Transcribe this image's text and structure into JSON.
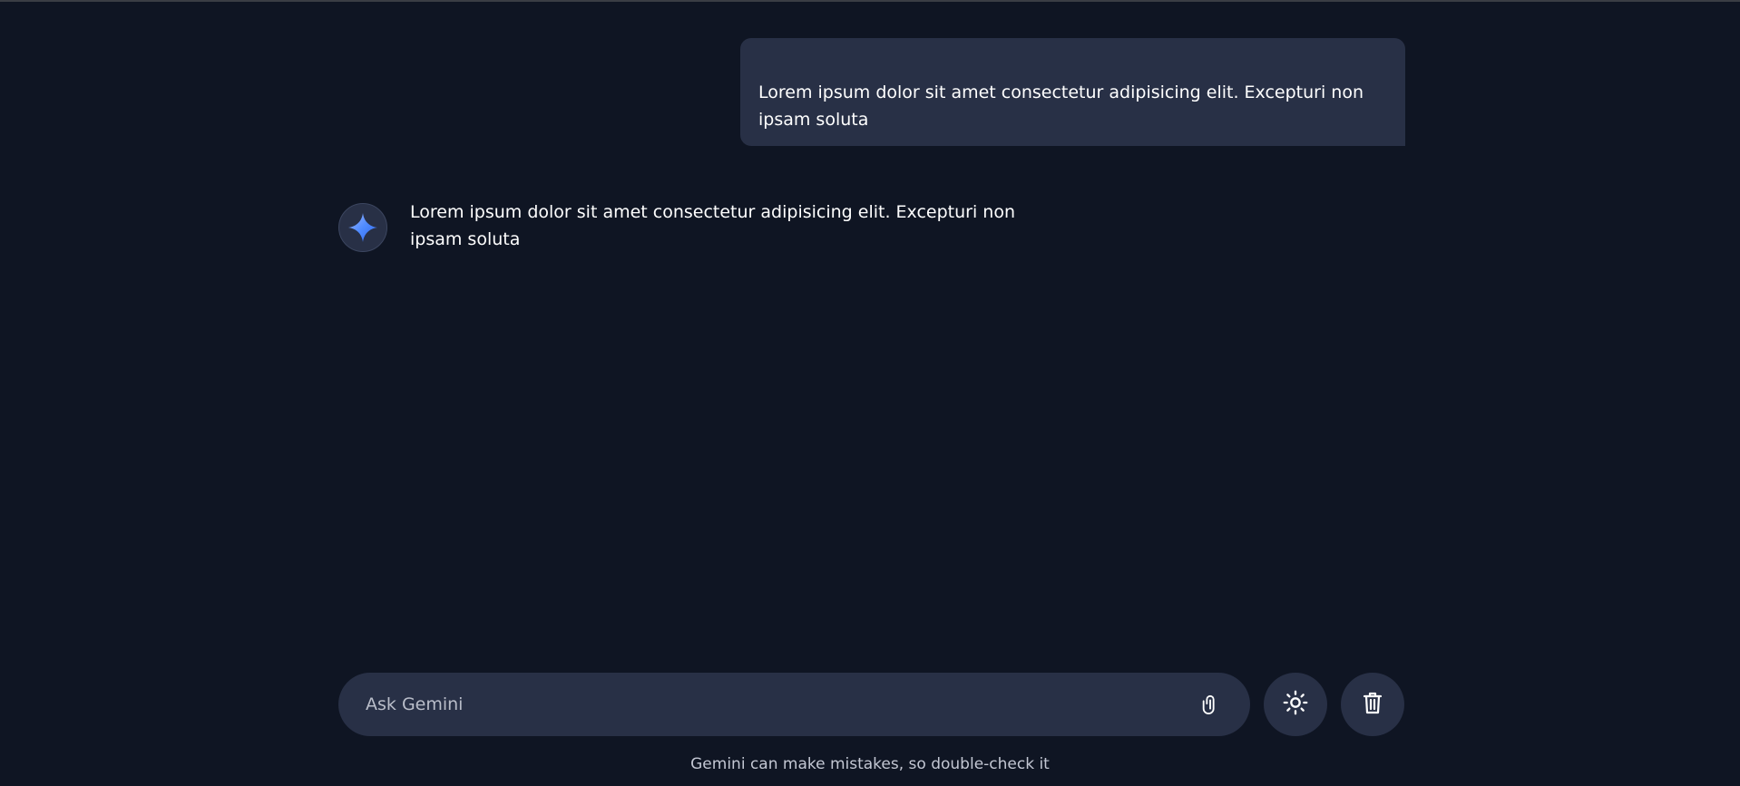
{
  "colors": {
    "background": "#0f1523",
    "surface": "#283046",
    "text": "#ffffff",
    "muted": "#c3c7d3",
    "accent_blue": "#4f8bff"
  },
  "conversation": {
    "user_message": "Lorem ipsum dolor sit amet consectetur adipisicing elit. Excepturi non ipsam soluta",
    "bot_message": "Lorem ipsum dolor sit amet consectetur adipisicing elit. Excepturi non ipsam soluta",
    "bot_avatar_icon": "gemini-sparkle-icon"
  },
  "composer": {
    "placeholder": "Ask Gemini",
    "value": "",
    "attach_icon": "paperclip-icon",
    "theme_icon": "sun-icon",
    "delete_icon": "trash-icon"
  },
  "footer": {
    "disclaimer": "Gemini can make mistakes, so double-check it"
  }
}
